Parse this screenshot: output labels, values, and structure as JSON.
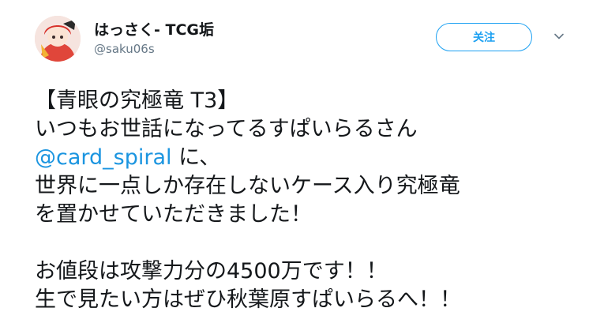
{
  "user": {
    "display_name": "はっさく- TCG垢",
    "handle": "@saku06s"
  },
  "actions": {
    "follow_label": "关注"
  },
  "tweet": {
    "line1": "【青眼の究極竜 T3】",
    "line2": "いつもお世話になってるすぱいらるさん",
    "line3_mention": "@card_spiral",
    "line3_rest": " に、",
    "line4": "世界に一点しか存在しないケース入り究極竜",
    "line5": "を置かせていただきました！",
    "line6": "お値段は攻撃力分の4500万です！！",
    "line7": "生で見たい方はぜひ秋葉原すぱいらるへ！！"
  },
  "colors": {
    "accent": "#1da1f2",
    "mention": "#1b95e0",
    "secondary_text": "#657786"
  },
  "icons": {
    "avatar": "avatar-image",
    "caret": "chevron-down-icon"
  }
}
